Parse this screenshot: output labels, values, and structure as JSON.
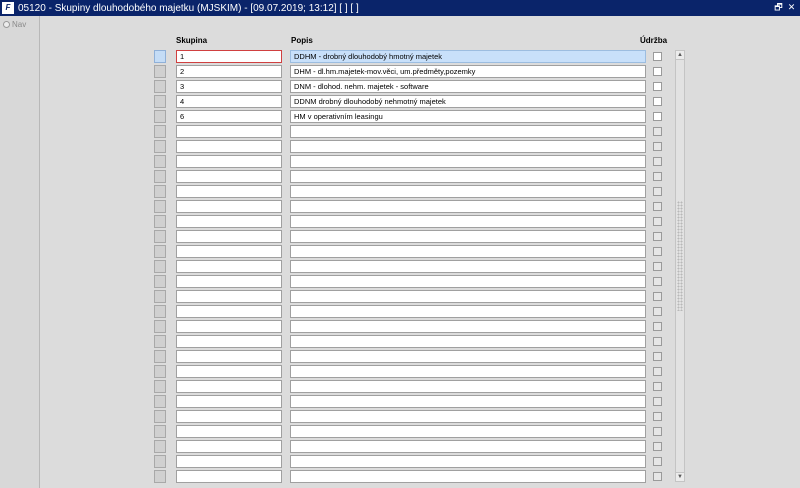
{
  "window": {
    "app_icon": "oracle-forms-icon",
    "title": "05120 - Skupiny dlouhodobého majetku (MJSKIM) - [09.07.2019; 13:12]  [ ]  [ ]",
    "restore_glyph": "🗗",
    "close_glyph": "✕"
  },
  "nav": {
    "label": "Nav"
  },
  "columns": {
    "skupina": "Skupina",
    "popis": "Popis",
    "udrzba": "Údržba"
  },
  "rows": [
    {
      "skupina": "1",
      "popis": "DDHM - drobný dlouhodobý hmotný majetek"
    },
    {
      "skupina": "2",
      "popis": "DHM - dl.hm.majetek-mov.věci, um.předměty,pozemky"
    },
    {
      "skupina": "3",
      "popis": "DNM - dlohod. nehm. majetek - software"
    },
    {
      "skupina": "4",
      "popis": "DDNM  drobný dlouhodobý nehmotný majetek"
    },
    {
      "skupina": "6",
      "popis": "HM v operativním leasingu"
    },
    {
      "skupina": "",
      "popis": ""
    },
    {
      "skupina": "",
      "popis": ""
    },
    {
      "skupina": "",
      "popis": ""
    },
    {
      "skupina": "",
      "popis": ""
    },
    {
      "skupina": "",
      "popis": ""
    },
    {
      "skupina": "",
      "popis": ""
    },
    {
      "skupina": "",
      "popis": ""
    },
    {
      "skupina": "",
      "popis": ""
    },
    {
      "skupina": "",
      "popis": ""
    },
    {
      "skupina": "",
      "popis": ""
    },
    {
      "skupina": "",
      "popis": ""
    },
    {
      "skupina": "",
      "popis": ""
    },
    {
      "skupina": "",
      "popis": ""
    },
    {
      "skupina": "",
      "popis": ""
    },
    {
      "skupina": "",
      "popis": ""
    },
    {
      "skupina": "",
      "popis": ""
    },
    {
      "skupina": "",
      "popis": ""
    },
    {
      "skupina": "",
      "popis": ""
    },
    {
      "skupina": "",
      "popis": ""
    },
    {
      "skupina": "",
      "popis": ""
    },
    {
      "skupina": "",
      "popis": ""
    },
    {
      "skupina": "",
      "popis": ""
    },
    {
      "skupina": "",
      "popis": ""
    },
    {
      "skupina": "",
      "popis": ""
    }
  ],
  "current_row": 0,
  "filled_rows": 5,
  "colors": {
    "titlebar": "#0a246a",
    "current_row": "#c8e0fa",
    "focus_border": "#d04040"
  }
}
